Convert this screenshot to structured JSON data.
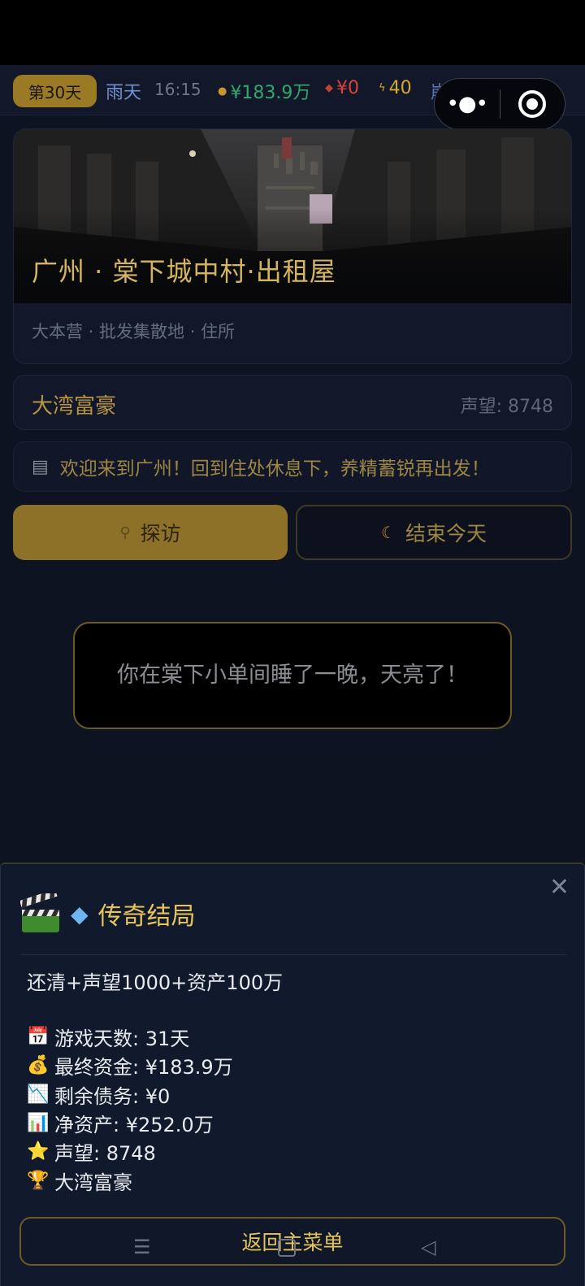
{
  "topbar": {
    "day": "第30天",
    "weather": "雨天",
    "time": "16:15",
    "money": "¥183.9万",
    "debt": "¥0",
    "energy": "40",
    "collapse": "崩溃",
    "colors": {
      "money": "#2fa86b",
      "debt": "#d9443a",
      "energy": "#d7a92a",
      "weather": "#6f8fcf"
    }
  },
  "capsule": {
    "more_icon": "more-dots-icon",
    "target_icon": "target-icon"
  },
  "location": {
    "title": "广州 · 棠下城中村·出租屋",
    "tags": "大本营 · 批发集散地 · 住所"
  },
  "rank": {
    "title": "大湾富豪",
    "fame": "声望: 8748"
  },
  "welcome": {
    "icon": "newspaper-icon",
    "text": "欢迎来到广州！回到住处休息下，养精蓄锐再出发！"
  },
  "actions": {
    "explore": {
      "label": "探访",
      "icon": "magnifier-icon"
    },
    "end_day": {
      "label": "结束今天",
      "icon": "moon-icon"
    }
  },
  "toast": {
    "text": "你在棠下小单间睡了一晚，天亮了！"
  },
  "modal": {
    "title": "传奇结局",
    "condition": "还清+声望1000+资产100万",
    "stats": [
      {
        "icon": "calendar-icon",
        "glyph": "📅",
        "text": "游戏天数: 31天"
      },
      {
        "icon": "money-bag-icon",
        "glyph": "💰",
        "text": "最终资金: ¥183.9万"
      },
      {
        "icon": "chart-down-icon",
        "glyph": "📉",
        "text": "剩余债务: ¥0"
      },
      {
        "icon": "bar-chart-icon",
        "glyph": "📊",
        "text": "净资产: ¥252.0万"
      },
      {
        "icon": "star-icon",
        "glyph": "⭐",
        "text": "声望: 8748"
      },
      {
        "icon": "trophy-icon",
        "glyph": "🏆",
        "text": "大湾富豪"
      }
    ],
    "button": "返回主菜单"
  }
}
